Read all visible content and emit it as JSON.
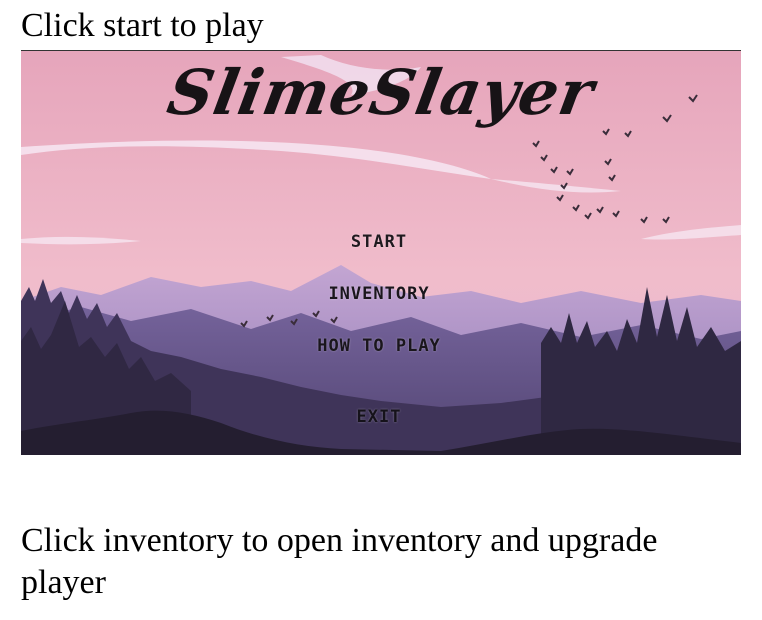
{
  "captions": {
    "top": "Click start to play",
    "bottom": "Click inventory to open inventory and upgrade player"
  },
  "game": {
    "title": "SlimeSlayer",
    "menu": {
      "start": "START",
      "inventory": "INVENTORY",
      "how_to_play": "HOW TO PLAY",
      "exit": "EXIT"
    }
  },
  "colors": {
    "sky_top": "#e8a8bd",
    "sky_bottom": "#f2c3cf",
    "mountain_far": "#b59bc9",
    "mountain_mid": "#7f6aa3",
    "forest_dark": "#3e3456",
    "ground": "#2a2338",
    "menu_text": "#1f1a1f"
  }
}
